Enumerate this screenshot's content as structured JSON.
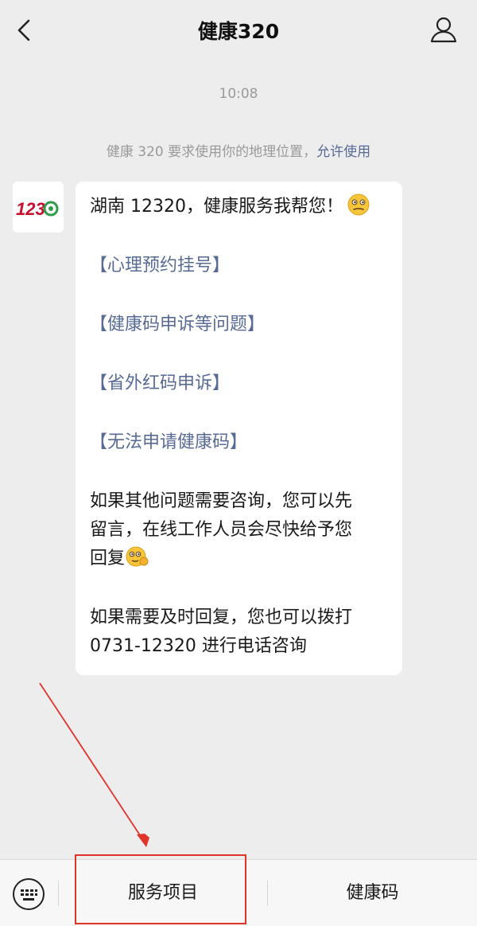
{
  "header": {
    "title": "健康320",
    "back_icon": "chevron-left-icon",
    "profile_icon": "person-icon"
  },
  "chat": {
    "timestamp": "10:08",
    "system_message": {
      "text": "健康 320 要求使用你的地理位置，",
      "action": "允许使用"
    },
    "avatar_text": "12320",
    "message": {
      "greeting": "湖南 12320，健康服务我帮您！",
      "links": [
        "【心理预约挂号】",
        "【健康码申诉等问题】",
        "【省外红码申诉】",
        "【无法申请健康码】"
      ],
      "paragraph1_lines": [
        "如果其他问题需要咨询，您可以先",
        "留言，在线工作人员会尽快给予您",
        "回复"
      ],
      "paragraph2_lines": [
        "如果需要及时回复，您也可以拨打",
        "0731-12320 进行电话咨询"
      ]
    }
  },
  "bottom_menu": {
    "keyboard_icon": "keyboard-icon",
    "items": [
      "服务项目",
      "健康码"
    ]
  },
  "colors": {
    "background": "#ededed",
    "bubble": "#ffffff",
    "link": "#576b95",
    "annotation": "#e0342a"
  }
}
